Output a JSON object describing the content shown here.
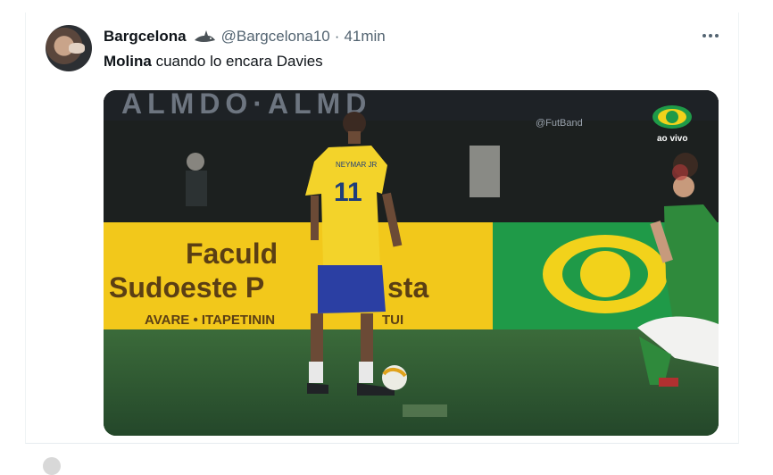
{
  "tweet": {
    "display_name": "Bargcelona",
    "handle": "@Bargcelona10",
    "separator": "·",
    "time": "41min",
    "text_bold": "Molina",
    "text_rest": " cuando lo encara Davies",
    "more_icon": "more-dots-icon",
    "badge_icon": "shark-icon"
  },
  "video": {
    "board_line1": "Faculd",
    "board_line2a": "Sudoeste P",
    "board_line2b": "sta",
    "board_line3": "AVARE • ITAPETININ",
    "board_line3b": "TUI",
    "shirt_text": "NEYMAR JR",
    "shirt_number": "11",
    "watermark": "@FutBand",
    "channel_label": "ao vivo",
    "colors": {
      "board_yellow": "#f2c81b",
      "board_green": "#1f9a48",
      "jersey_yellow": "#f3d32a",
      "shorts_blue": "#2b3fa3",
      "pitch": "#2e5a2e"
    }
  }
}
